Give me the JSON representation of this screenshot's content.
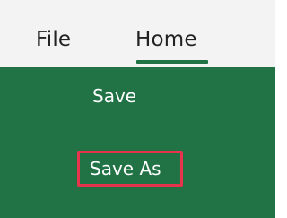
{
  "tabs": {
    "file_label": "File",
    "home_label": "Home",
    "active_tab": "Home"
  },
  "menu": {
    "save_label": "Save",
    "save_as_label": "Save As",
    "highlighted_item": "Save As"
  },
  "colors": {
    "accent_green": "#217346",
    "highlight_red": "#e8334d",
    "tabbar_background": "#f3f3f3",
    "menu_text": "#ffffff"
  }
}
